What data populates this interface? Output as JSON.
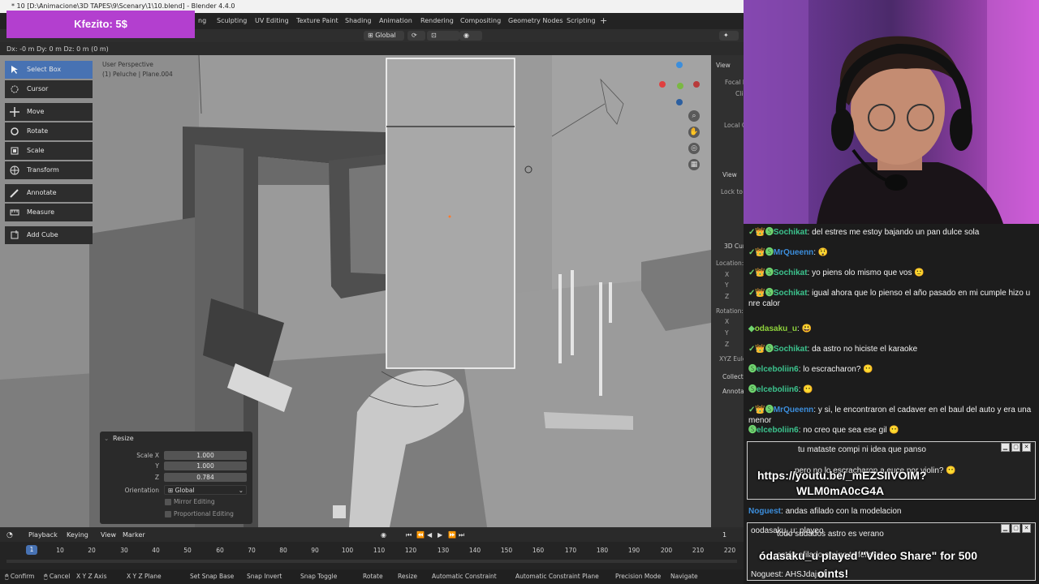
{
  "window": {
    "title": "* 10 [D:\\Animacione\\3D TAPES\\9\\Scenary\\1\\10.blend] - Blender 4.4.0"
  },
  "workspace_tabs": [
    "Sculpting",
    "UV Editing",
    "Texture Paint",
    "Shading",
    "Animation",
    "Rendering",
    "Compositing",
    "Geometry Nodes",
    "Scripting"
  ],
  "header": {
    "orientation": "Global"
  },
  "transform_status": "Dx: -0 m  Dy: 0 m  Dz: 0 m (0 m)",
  "viewport": {
    "view_name": "User Perspective",
    "object_info": "(1) Peluche | Plane.004",
    "right_panel": {
      "view_tab": "View",
      "focal": "Focal l",
      "clip": "Cli",
      "local_camera": "Local C",
      "view_lock": "View",
      "lock_to": "Lock to",
      "cursor_title": "3D Curs",
      "location_label": "Location:",
      "x": "X",
      "y": "Y",
      "z": "Z",
      "rotation_label": "Rotation:",
      "rx": "X",
      "ry": "Y",
      "rz": "Z",
      "euler": "XYZ Eule",
      "collections": "Collecti",
      "annotations": "Annotat"
    }
  },
  "toolbar": {
    "tools": [
      {
        "label": "Select Box",
        "icon": "select-box-icon"
      },
      {
        "label": "Cursor",
        "icon": "cursor-icon"
      },
      {
        "label": "Move",
        "icon": "move-icon"
      },
      {
        "label": "Rotate",
        "icon": "rotate-icon"
      },
      {
        "label": "Scale",
        "icon": "scale-icon"
      },
      {
        "label": "Transform",
        "icon": "transform-icon"
      },
      {
        "label": "Annotate",
        "icon": "annotate-icon"
      },
      {
        "label": "Measure",
        "icon": "measure-icon"
      },
      {
        "label": "Add Cube",
        "icon": "add-cube-icon"
      }
    ]
  },
  "resize_panel": {
    "title": "Resize",
    "scale_x_label": "Scale X",
    "scale_x": "1.000",
    "y_label": "Y",
    "scale_y": "1.000",
    "z_label": "Z",
    "scale_z": "0.784",
    "orientation_label": "Orientation",
    "orientation_value": "Global",
    "mirror_editing": "Mirror Editing",
    "proportional_editing": "Proportional Editing"
  },
  "timeline": {
    "menus": [
      "Playback",
      "Keying",
      "View",
      "Marker"
    ],
    "current_frame": "1",
    "frame_display": "1",
    "ticks": [
      "10",
      "20",
      "30",
      "40",
      "50",
      "60",
      "70",
      "80",
      "90",
      "100",
      "110",
      "120",
      "130",
      "140",
      "150",
      "160",
      "170",
      "180",
      "190",
      "200",
      "210",
      "220"
    ]
  },
  "statusbar": [
    "Confirm",
    "Cancel",
    "X Y Z Axis",
    "X Y Z Plane",
    "Set Snap Base",
    "Snap Invert",
    "Snap Toggle",
    "Rotate",
    "Resize",
    "Automatic Constraint",
    "Automatic Constraint Plane",
    "Precision Mode",
    "Navigate"
  ],
  "donation": {
    "text": "Kfezito: 5$"
  },
  "chat": {
    "messages": [
      {
        "badges": "✓👑🅢",
        "user": "Sochikat",
        "color": "#3cc48e",
        "text": "del estres me estoy bajando un pan dulce sola"
      },
      {
        "badges": "✓👑🅢",
        "user": "MrQueenn",
        "color": "#3c8edc",
        "text": "😲"
      },
      {
        "badges": "✓👑🅢",
        "user": "Sochikat",
        "color": "#3cc48e",
        "text": "yo piens olo mismo que vos 🙂"
      },
      {
        "badges": "✓👑🅢",
        "user": "Sochikat",
        "color": "#3cc48e",
        "text": "igual ahora que lo pienso el año pasado en mi cumple hizo u nre calor"
      },
      {
        "badges": "◆",
        "user": "odasaku_u",
        "color": "#8fd43c",
        "text": "😃"
      },
      {
        "badges": "✓👑🅢",
        "user": "Sochikat",
        "color": "#3cc48e",
        "text": "da astro no hiciste el karaoke"
      },
      {
        "badges": "🅢",
        "user": "elceboliin6",
        "color": "#3cc48e",
        "text": "lo escracharon? 😶"
      },
      {
        "badges": "🅢",
        "user": "elceboliin6",
        "color": "#3cc48e",
        "text": "😶"
      },
      {
        "badges": "✓👑🅢",
        "user": "MrQueenn",
        "color": "#3c8edc",
        "text": "y si, le encontraron el cadaver en el baul del auto y era una menor"
      },
      {
        "badges": "🅢",
        "user": "elceboliin6",
        "color": "#3cc48e",
        "text": "no creo que sea ese gil 😶"
      },
      {
        "badges": "",
        "user": "Noguest",
        "color": "#3c8edc",
        "text": "andas afilado con la modelacion"
      }
    ],
    "popup1_lines": [
      "tu mataste compi ni idea que panso",
      "pero no lo escracharon a euce por violin? 😶",
      "https://youtu.be/_mEZSIIVOIM?",
      "WLM0mA0cG4A"
    ],
    "popup2_lines": [
      "oodasaku_u: playeo",
      "todo sudados astro es verano",
      "estás afilado amigo te felicito",
      "ódasaku_u played \"Video Share\" for 500",
      "Noguest: AHSJdajsd",
      "oints!"
    ]
  }
}
